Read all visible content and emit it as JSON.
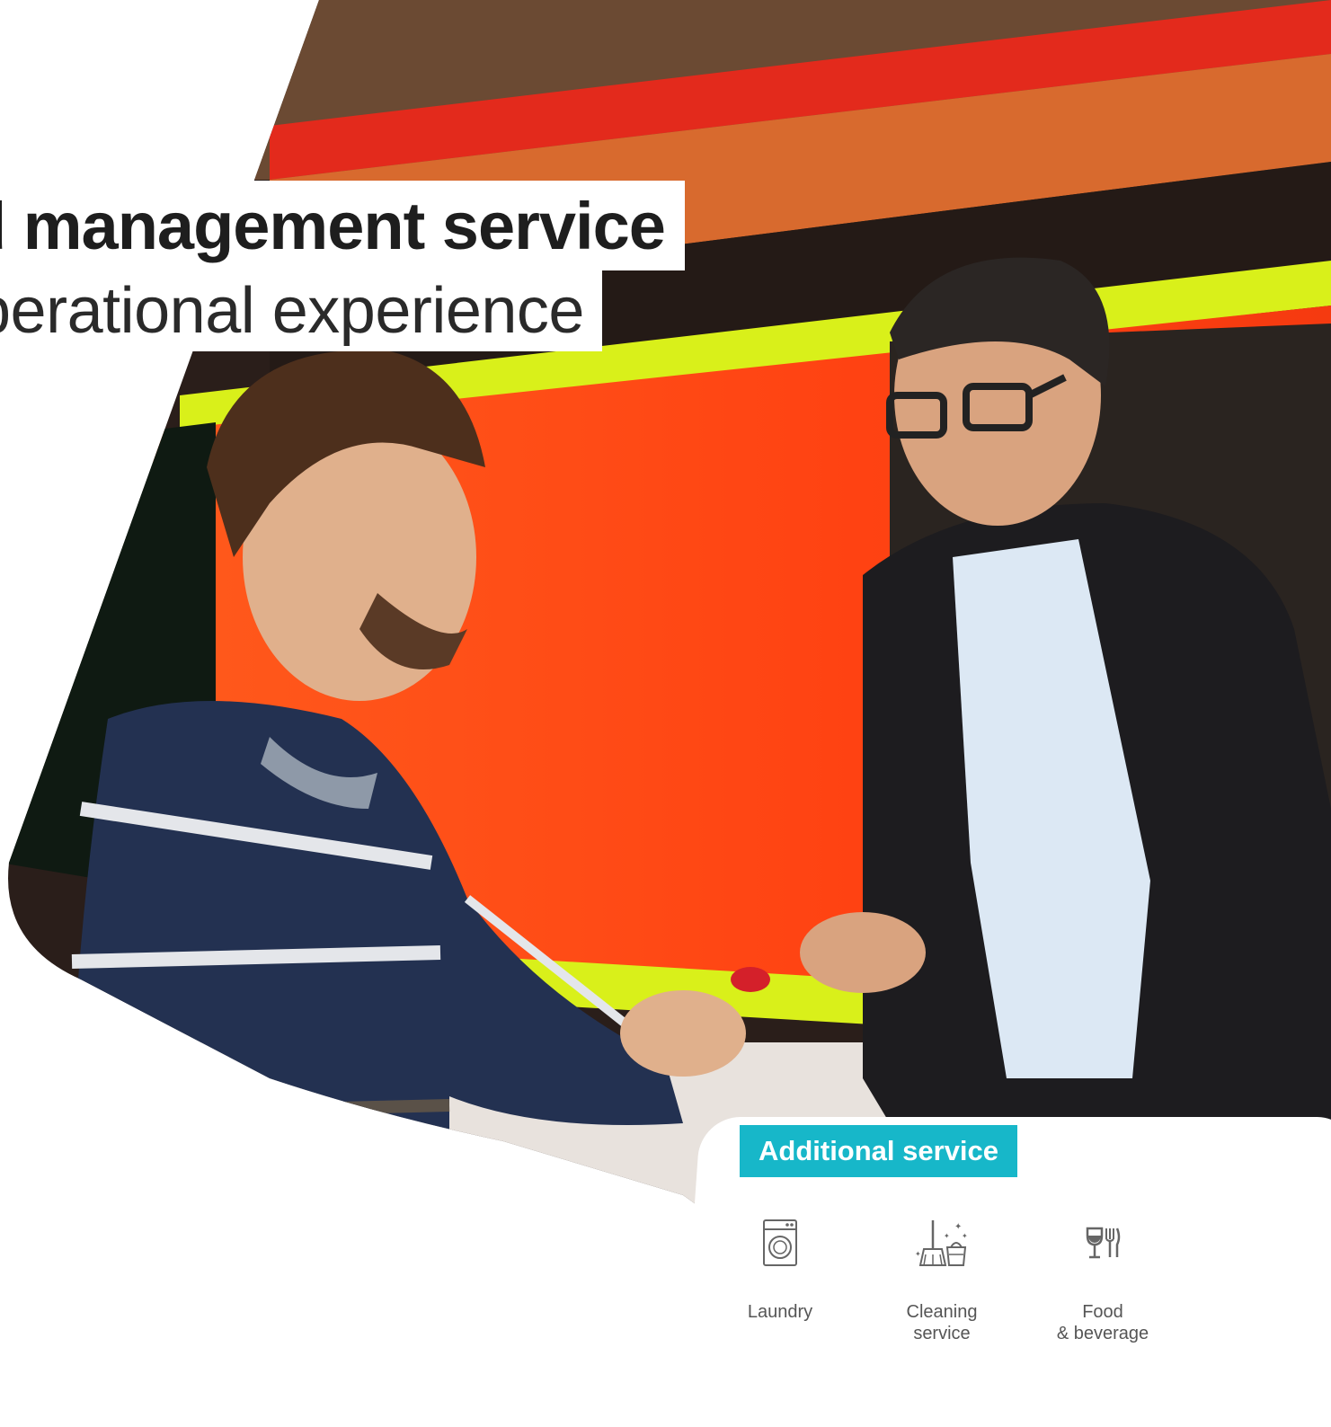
{
  "headline": {
    "title": "d management service",
    "subtitle": "perational experience"
  },
  "hero_image": {
    "description_icon": "photo",
    "colors": {
      "wall_orange": "#ff4b14",
      "stripe_yellow": "#d9f01a",
      "stripe_red": "#e5201b",
      "dark": "#1b1b1b"
    }
  },
  "additional_service": {
    "heading": "Additional service",
    "accent_color": "#17b7c9",
    "items": [
      {
        "label": "Laundry",
        "icon": "washing-machine-icon"
      },
      {
        "label": "Cleaning\nservice",
        "icon": "cleaning-icon"
      },
      {
        "label": "Food\n& beverage",
        "icon": "food-beverage-icon"
      }
    ]
  }
}
